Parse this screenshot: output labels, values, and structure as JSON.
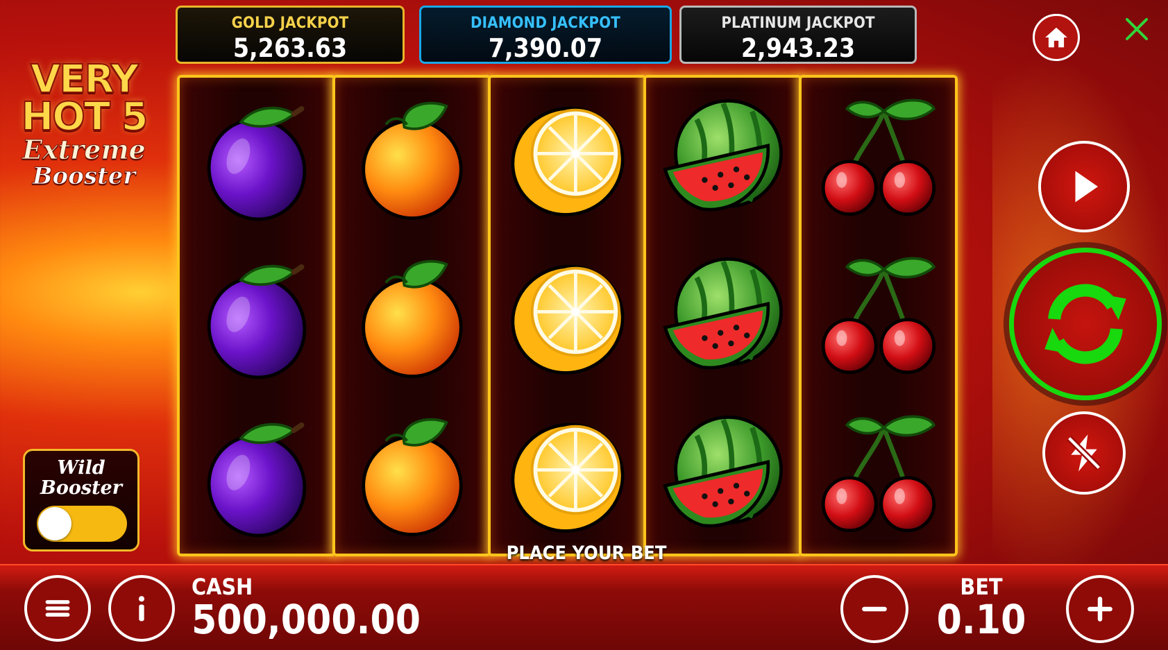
{
  "jackpots": [
    {
      "label": "GOLD JACKPOT",
      "value": "5,263.63"
    },
    {
      "label": "DIAMOND JACKPOT",
      "value": "7,390.07"
    },
    {
      "label": "PLATINUM JACKPOT",
      "value": "2,943.23"
    }
  ],
  "logo": {
    "line1": "VERY",
    "line2": "HOT 5",
    "line3": "Extreme",
    "line4": "Booster"
  },
  "reels": [
    [
      "plum",
      "plum",
      "plum"
    ],
    [
      "orange",
      "orange",
      "orange"
    ],
    [
      "lemon",
      "lemon",
      "lemon"
    ],
    [
      "watermelon",
      "watermelon",
      "watermelon"
    ],
    [
      "cherry",
      "cherry",
      "cherry"
    ]
  ],
  "status_text": "PLACE YOUR BET",
  "wild_booster": {
    "line1": "Wild",
    "line2": "Booster",
    "enabled": false
  },
  "cash": {
    "label": "CASH",
    "value": "500,000.00"
  },
  "bet": {
    "label": "BET",
    "value": "0.10"
  },
  "icons": [
    "home-icon",
    "close-icon",
    "play-icon",
    "spin-icon",
    "autoplay-off-icon",
    "menu-icon",
    "info-icon",
    "minus-icon",
    "plus-icon"
  ],
  "colors": {
    "gold": "#e9b52a",
    "diamond": "#1aa8e8",
    "platinum": "#b9b9b9",
    "spin_ring": "#18d80e",
    "reel_frame": "#ffc51c"
  }
}
